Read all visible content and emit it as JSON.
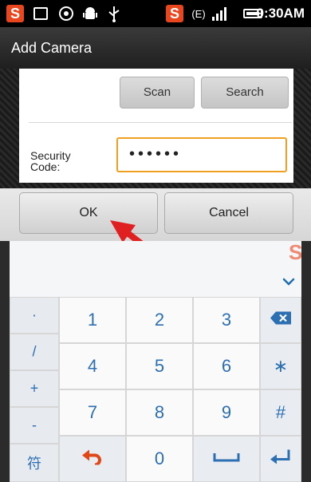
{
  "status_bar": {
    "time": "9:30AM",
    "data_indicator": "(E)",
    "icons": [
      "sogou-s-icon",
      "image-icon",
      "gallery-icon",
      "android-icon",
      "usb-icon",
      "sogou-s-icon",
      "data-indicator-icon",
      "signal-icon",
      "battery-icon"
    ]
  },
  "dialog": {
    "title": "Add Camera",
    "scan_label": "Scan",
    "search_label": "Search",
    "security_label": "Security Code:",
    "security_value": "••••••",
    "ok_label": "OK",
    "cancel_label": "Cancel"
  },
  "keyboard": {
    "side_keys": [
      "·",
      "/",
      "+",
      "-",
      "符"
    ],
    "rows": [
      [
        "1",
        "2",
        "3"
      ],
      [
        "4",
        "5",
        "6"
      ],
      [
        "7",
        "8",
        "9"
      ]
    ],
    "zero": "0",
    "star": "∗",
    "hash": "#",
    "icons": [
      "backspace-icon",
      "undo-icon",
      "space-icon",
      "enter-icon",
      "chevron-down-icon",
      "sogou-s-icon"
    ]
  },
  "colors": {
    "accent_orange": "#f0a020",
    "key_blue": "#2d6fb3",
    "arrow_red": "#e02020",
    "sogou_orange": "#e8461f"
  }
}
